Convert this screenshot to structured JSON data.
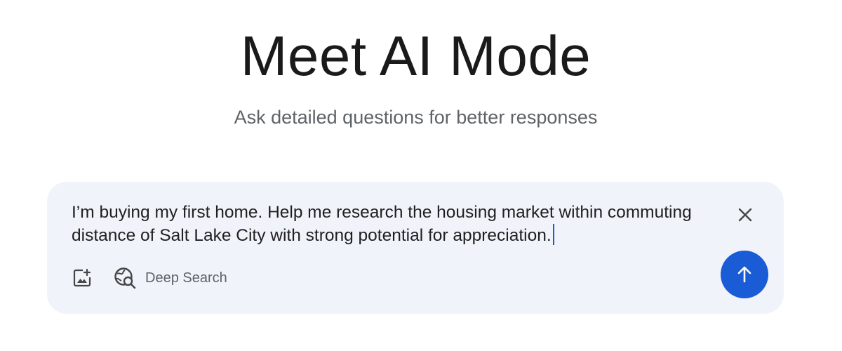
{
  "header": {
    "title": "Meet AI Mode",
    "subtitle": "Ask detailed questions for better responses"
  },
  "search": {
    "query": "I’m buying my first home. Help me research the housing market within commuting distance of Salt Lake City with strong potential for appreciation.",
    "deep_search_label": "Deep Search"
  },
  "icons": {
    "clear": "close-icon",
    "image": "add-image-icon",
    "deep_search": "deep-search-globe-icon",
    "submit": "arrow-up-icon"
  },
  "colors": {
    "accent": "#1a5bd6",
    "search_box_bg": "#f0f3fa",
    "title": "#1a1a1a",
    "subtitle": "#5f6368"
  }
}
